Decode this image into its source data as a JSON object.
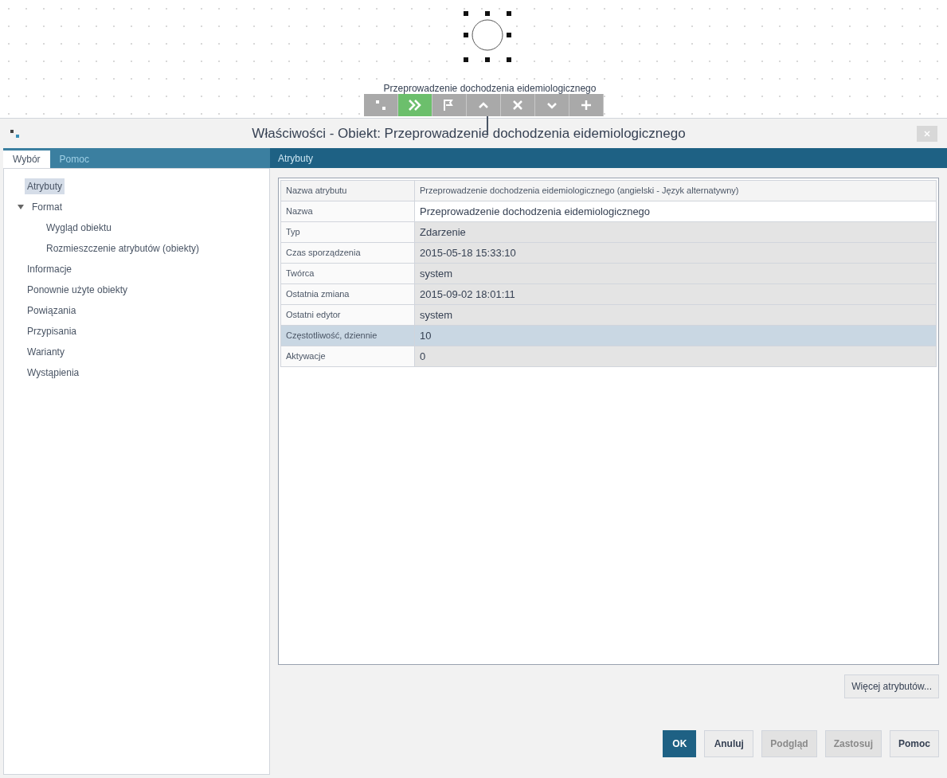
{
  "canvas": {
    "node_label": "Przeprowadzenie dochodzenia eidemiologicznego",
    "toolbar": [
      {
        "kind": "dots",
        "selected": false
      },
      {
        "kind": "forward",
        "selected": true
      },
      {
        "kind": "flag",
        "selected": false
      },
      {
        "kind": "up",
        "selected": false
      },
      {
        "kind": "close",
        "selected": false
      },
      {
        "kind": "down",
        "selected": false
      },
      {
        "kind": "plus",
        "selected": false
      }
    ]
  },
  "window": {
    "title": "Właściwości - Obiekt: Przeprowadzenie dochodzenia eidemiologicznego"
  },
  "tabs": [
    {
      "label": "Wybór",
      "selected": true
    },
    {
      "label": "Pomoc",
      "selected": false
    }
  ],
  "tree": [
    {
      "label": "Atrybuty",
      "selected": true
    },
    {
      "label": "Format",
      "selected": false,
      "expanded": true,
      "children": [
        {
          "label": "Wygląd obiektu",
          "selected": false
        },
        {
          "label": "Rozmieszczenie atrybutów (obiekty)",
          "selected": false
        }
      ]
    },
    {
      "label": "Informacje",
      "selected": false
    },
    {
      "label": "Ponownie użyte obiekty",
      "selected": false
    },
    {
      "label": "Powiązania",
      "selected": false
    },
    {
      "label": "Przypisania",
      "selected": false
    },
    {
      "label": "Warianty",
      "selected": false
    },
    {
      "label": "Wystąpienia",
      "selected": false
    }
  ],
  "panel": {
    "title": "Atrybuty",
    "table": {
      "columns": [
        "Nazwa atrybutu",
        "Przeprowadzenie dochodzenia eidemiologicznego (angielski - Język alternatywny)"
      ],
      "rows": [
        {
          "name": "Nazwa",
          "value": "Przeprowadzenie dochodzenia eidemiologicznego",
          "editable": true,
          "selected": false
        },
        {
          "name": "Typ",
          "value": "Zdarzenie",
          "editable": false,
          "selected": false
        },
        {
          "name": "Czas sporządzenia",
          "value": "2015-05-18 15:33:10",
          "editable": false,
          "selected": false
        },
        {
          "name": "Twórca",
          "value": "system",
          "editable": false,
          "selected": false
        },
        {
          "name": "Ostatnia zmiana",
          "value": "2015-09-02 18:01:11",
          "editable": false,
          "selected": false
        },
        {
          "name": "Ostatni edytor",
          "value": "system",
          "editable": false,
          "selected": false
        },
        {
          "name": "Częstotliwość, dziennie",
          "value": "10",
          "editable": true,
          "selected": true
        },
        {
          "name": "Aktywacje",
          "value": "0",
          "editable": false,
          "selected": false
        }
      ]
    },
    "more_button": "Więcej atrybutów..."
  },
  "buttons": [
    {
      "label": "OK",
      "kind": "primary",
      "disabled": false
    },
    {
      "label": "Anuluj",
      "kind": "normal",
      "disabled": false
    },
    {
      "label": "Podgląd",
      "kind": "normal",
      "disabled": true
    },
    {
      "label": "Zastosuj",
      "kind": "normal",
      "disabled": true
    },
    {
      "label": "Pomoc",
      "kind": "normal",
      "disabled": false
    }
  ]
}
